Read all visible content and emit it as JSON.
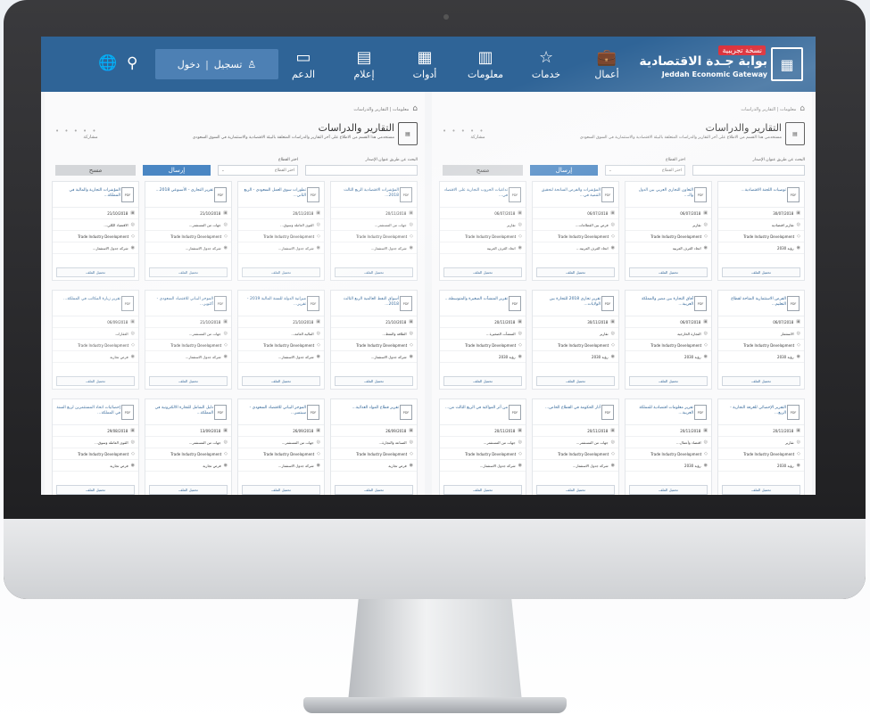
{
  "header": {
    "brand_badge": "نسخة تجريبية",
    "brand_ar": "بوابة جـدة الاقتصادية",
    "brand_en": "Jeddah Economic Gateway",
    "nav": [
      {
        "label": "أعمال",
        "icon": "briefcase-icon",
        "glyph": "💼"
      },
      {
        "label": "خدمات",
        "icon": "star-icon",
        "glyph": "☆"
      },
      {
        "label": "معلومات",
        "icon": "bar-chart-icon",
        "glyph": "▥"
      },
      {
        "label": "أدوات",
        "icon": "calculator-icon",
        "glyph": "▦"
      },
      {
        "label": "إعلام",
        "icon": "calendar-icon",
        "glyph": "▤"
      },
      {
        "label": "الدعم",
        "icon": "support-icon",
        "glyph": "▭"
      }
    ],
    "login_label": "تسجيل",
    "login_sep": "|",
    "register_label": "دخول",
    "search_icon": "⚲",
    "globe_icon": "🌐"
  },
  "page": {
    "breadcrumb_home": "⌂",
    "breadcrumb": "معلومات  |  التقارير والدراسات",
    "title": "التقارير والدراسات",
    "subtitle": "مستخدمي هذا القسم من الاطلاع على آخر التقارير والدراسات المتعلقة بالبيئة الاقتصادية والاستثمارية في السوق السعودي",
    "share_label": "مشاركة",
    "share_dots": "• • • • •",
    "filters": {
      "search_label": "البحث عن طريق عنوان الإصدار",
      "sector_label": "اختر القطاع",
      "sector_value": "اختر القطاع",
      "send_label": "إرسال",
      "clear_label": "مسح"
    }
  },
  "cards_right": [
    {
      "title": "توصيات اللجنة الاقتصادية...",
      "date": "30/07/2018",
      "field1": "تقارير اقتصادية",
      "org": "Trade Industry Development",
      "type": "رؤية 2030",
      "btn": "تحميل الملف"
    },
    {
      "title": "التعاون التجاري العربي بين الدول والـ...",
      "date": "06/07/2018",
      "field1": "تقارير",
      "org": "Trade Industry Development",
      "type": "اتحاد الغرف العربية",
      "btn": "تحميل الملف"
    },
    {
      "title": "المؤشرات والفرص السانحة لتحقيق التنمية في...",
      "date": "06/07/2018",
      "field1": "فرص بين القطاعات...",
      "org": "Trade Industry Development",
      "type": "اتحاد الغرف العربية...",
      "btn": "تحميل الملف"
    },
    {
      "title": "تداعيات الحروب التجارية على الاقتصاد في...",
      "date": "06/07/2018",
      "field1": "تقارير",
      "org": "Trade Industry Development",
      "type": "اتحاد الغرف العربية",
      "btn": "تحميل الملف"
    },
    {
      "title": "الفرص الاستثمارية المتاحة لقطاع التعليم...",
      "date": "06/07/2018",
      "field1": "الاستثمار",
      "org": "Trade Industry Development",
      "type": "رؤية 2030",
      "btn": "تحميل الملف"
    },
    {
      "title": "آفاق التجارة بين مصر والمملكة العربية...",
      "date": "06/07/2018",
      "field1": "التجارة الخارجية",
      "org": "Trade Industry Development",
      "type": "رؤية 2030",
      "btn": "تحميل الملف"
    },
    {
      "title": "تقرير تجاري 2018 للتجارة بين الولايات...",
      "date": "30/11/2018",
      "field1": "تقارير",
      "org": "Trade Industry Development",
      "type": "رؤية 2030",
      "btn": "تحميل الملف"
    },
    {
      "title": "تقرير المنشآت الصغيرة والمتوسطة...",
      "date": "20/11/2018",
      "field1": "المنشآت الصغيرة...",
      "org": "Trade Industry Development",
      "type": "رؤية 2030",
      "btn": "تحميل الملف"
    },
    {
      "title": "التقرير الإحصائي للغرفة التجارية - الربع...",
      "date": "20/11/2018",
      "field1": "تقارير",
      "org": "Trade Industry Development",
      "type": "رؤية 2030",
      "btn": "تحميل الملف"
    },
    {
      "title": "تقرير معلومات اقتصادية للمملكة العربية...",
      "date": "20/11/2018",
      "field1": "اقتصاد وأعمال...",
      "org": "Trade Industry Development",
      "type": "رؤية 2030",
      "btn": "تحميل الملف"
    },
    {
      "title": "أثار الحكومة في القطاع الخاص...",
      "date": "20/11/2018",
      "field1": "جهات من المستثمر...",
      "org": "Trade Industry Development",
      "type": "شركة جدول الاستثمار...",
      "btn": "تحميل الملف"
    },
    {
      "title": "من أثر المواكبة في الربع الثالث من...",
      "date": "20/11/2018",
      "field1": "جهات من المستثمر...",
      "org": "Trade Industry Development",
      "type": "شركة جدول الاستثمار...",
      "btn": "تحميل الملف"
    }
  ],
  "cards_left": [
    {
      "title": "المؤشرات الاقتصادية الربع الثالث 2018...",
      "date": "20/11/2018",
      "field1": "جهات من المستثمر...",
      "org": "Trade Industry Development",
      "type": "شركة جدول الاستثمار...",
      "btn": "تحميل الملف"
    },
    {
      "title": "تطورات سوق العمل السعودي - الربع الثاني...",
      "date": "20/11/2018",
      "field1": "القوى العاملة وسوق...",
      "org": "Trade Industry Development",
      "type": "شركة جدول الاستثمار...",
      "btn": "تحميل الملف"
    },
    {
      "title": "تقرير التجاري - الأسبوعي 2018...",
      "date": "21/10/2018",
      "field1": "جهات من المستثمر...",
      "org": "Trade Industry Development",
      "type": "شركة جدول الاستثمار...",
      "btn": "تحميل الملف"
    },
    {
      "title": "المؤشرات التجارية والمالية في المملكة...",
      "date": "21/10/2018",
      "field1": "الاقتصاد الكلي...",
      "org": "Trade Industry Development",
      "type": "شركة جدول الاستثمار...",
      "btn": "تحميل الملف"
    },
    {
      "title": "أسواق النفط العالمية الربع الثالث 2018...",
      "date": "21/10/2018",
      "field1": "الطاقة والنفط...",
      "org": "Trade Industry Development",
      "type": "شركة جدول الاستثمار...",
      "btn": "تحميل الملف"
    },
    {
      "title": "ميزانية الدولة للسنة المالية 2019 - تقرير...",
      "date": "21/10/2018",
      "field1": "المالية العامة...",
      "org": "Trade Industry Development",
      "type": "شركة جدول الاستثمار...",
      "btn": "تحميل الملف"
    },
    {
      "title": "الموجز البياني للاقتصاد السعودي - أكتوبر...",
      "date": "21/10/2018",
      "field1": "جهات من المستثمر...",
      "org": "Trade Industry Development",
      "type": "شركة جدول الاستثمار...",
      "btn": "تحميل الملف"
    },
    {
      "title": "تقرير زيارة المكاتب في المملكة...",
      "date": "06/09/2018",
      "field1": "العقارات",
      "org": "Trade Industry Development",
      "type": "فرص تجارية",
      "btn": "تحميل الملف"
    },
    {
      "title": "تقرير قطاع المواد الغذائية...",
      "date": "26/09/2018",
      "field1": "الصناعة والتجارة...",
      "org": "Trade Industry Development",
      "type": "فرص تجارية",
      "btn": "تحميل الملف"
    },
    {
      "title": "الموجز البياني للاقتصاد السعودي - سبتمبر...",
      "date": "26/09/2018",
      "field1": "جهات من المستثمر...",
      "org": "Trade Industry Development",
      "type": "شركة جدول الاستثمار...",
      "btn": "تحميل الملف"
    },
    {
      "title": "دليل الشامل للتجارة الالكترونية في المملكة...",
      "date": "13/09/2018",
      "field1": "جهات من المستثمر...",
      "org": "Trade Industry Development",
      "type": "فرص تجارية",
      "btn": "تحميل الملف"
    },
    {
      "title": "إحصائيات اتحاد المستثمرين لربع السنة في المملكة...",
      "date": "29/08/2018",
      "field1": "القوى العاملة وسوق...",
      "org": "Trade Industry Development",
      "type": "فرص تجارية",
      "btn": "تحميل الملف"
    }
  ]
}
